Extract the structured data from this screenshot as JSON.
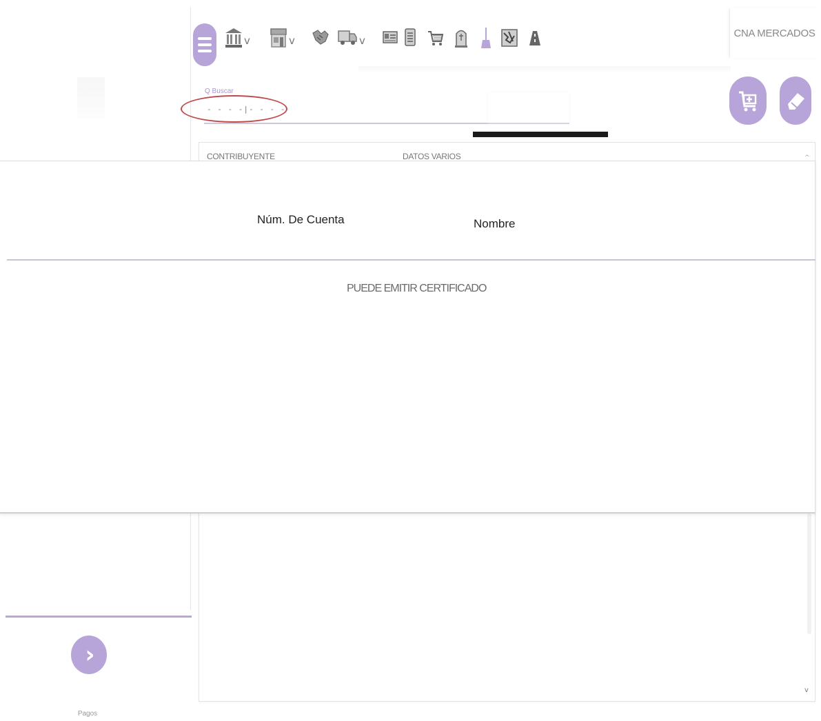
{
  "header": {
    "market_label": "CNA MERCADOS",
    "toolbar_icons": [
      {
        "name": "bank-icon",
        "has_dropdown": true
      },
      {
        "name": "storefront-icon",
        "has_dropdown": true
      },
      {
        "name": "handshake-icon",
        "has_dropdown": false
      },
      {
        "name": "truck-icon",
        "has_dropdown": true
      },
      {
        "name": "id-card-icon",
        "has_dropdown": false
      },
      {
        "name": "document-icon",
        "has_dropdown": false
      },
      {
        "name": "shopping-cart-icon",
        "has_dropdown": false
      },
      {
        "name": "tombstone-icon",
        "has_dropdown": false
      },
      {
        "name": "broom-icon",
        "has_dropdown": false
      },
      {
        "name": "map-icon",
        "has_dropdown": false
      },
      {
        "name": "road-icon",
        "has_dropdown": false
      }
    ],
    "dropdown_chevron": "v"
  },
  "search": {
    "label": "Q Buscar",
    "value": "- - - -|- - - -"
  },
  "tabs": [
    {
      "label": "CONTRIBUYENTE"
    },
    {
      "label": "DATOS VARIOS"
    }
  ],
  "popup": {
    "col_account": "Núm. De Cuenta",
    "col_name": "Nombre",
    "status": "PUEDE EMITIR CERTIFICADO"
  },
  "sidebar": {
    "next_label": "Pagos"
  },
  "scrollbar": {
    "up": "^",
    "down": "v"
  },
  "colors": {
    "accent": "#b7a4d8",
    "annotation": "#c04a4a",
    "redaction": "#1a1a1a"
  }
}
